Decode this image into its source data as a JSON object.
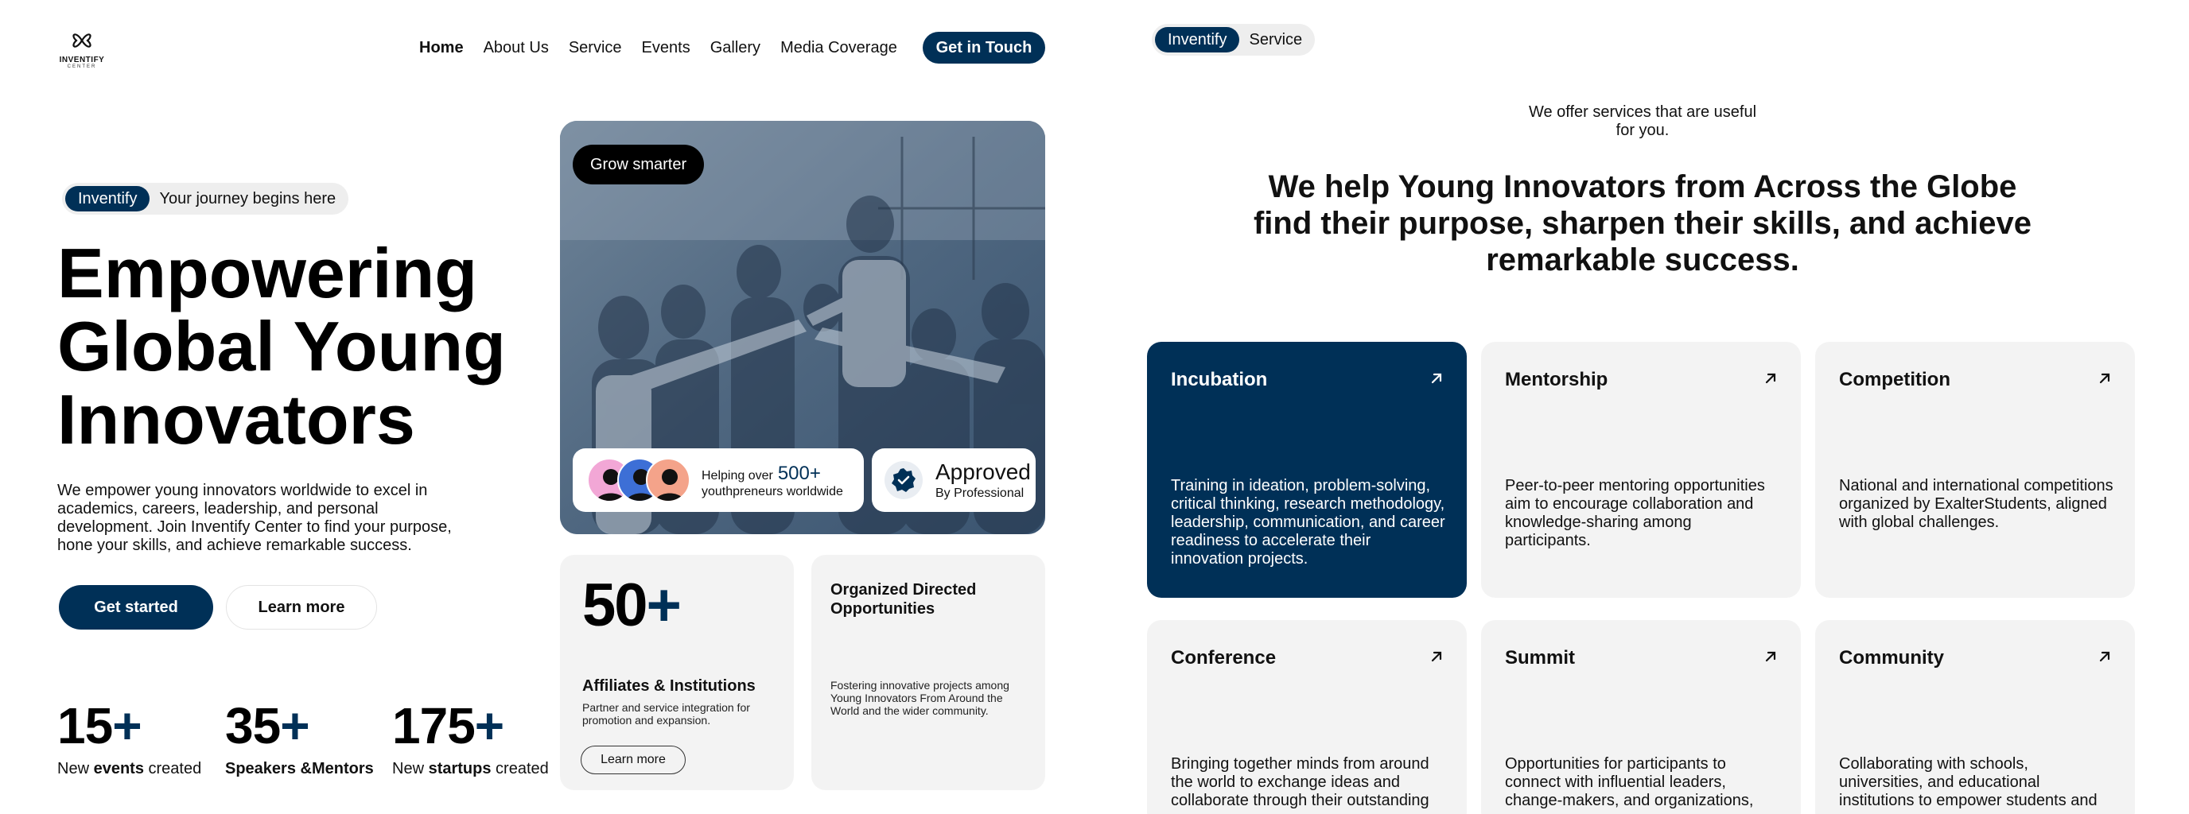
{
  "brand": {
    "name": "INVENTIFY",
    "sub": "CENTER"
  },
  "nav": {
    "items": [
      "Home",
      "About Us",
      "Service",
      "Events",
      "Gallery",
      "Media Coverage"
    ],
    "cta": "Get in Touch"
  },
  "hero": {
    "tag": "Inventify",
    "tagline": "Your journey begins here",
    "title_lines": [
      "Empowering",
      "Global Young",
      "Innovators"
    ],
    "description": "We empower young innovators worldwide to excel in academics, careers, leadership, and personal development. Join Inventify Center to find your purpose, hone your skills, and achieve remarkable success.",
    "primary_button": "Get started",
    "secondary_button": "Learn more"
  },
  "stats": [
    {
      "num": "15",
      "plus": "+",
      "pre": "New ",
      "bold": "events",
      "post": " created"
    },
    {
      "num": "35",
      "plus": "+",
      "pre": "",
      "bold": "Speakers &Mentors",
      "post": ""
    },
    {
      "num": "175",
      "plus": "+",
      "pre": "New ",
      "bold": "startups",
      "post": " created"
    }
  ],
  "photo_card": {
    "badge": "Grow smarter",
    "helping_prefix": "Helping over",
    "helping_count": "500+",
    "helping_suffix": "youthpreneurs worldwide",
    "approved_title": "Approved",
    "approved_sub": "By Professional"
  },
  "affiliates_card": {
    "number": "50",
    "plus": "+",
    "title": "Affiliates & Institutions",
    "description": "Partner and service integration for promotion and expansion.",
    "button": "Learn more"
  },
  "organized_card": {
    "title": "Organized Directed Opportunities",
    "description": "Fostering innovative projects among Young Innovators From Around the World and the wider community."
  },
  "services_page": {
    "tag": "Inventify",
    "tagline": "Service",
    "intro": "We offer services that are useful for you.",
    "headline": "We help Young Innovators from Across the Globe find their purpose, sharpen their skills, and achieve remarkable success.",
    "cards": [
      {
        "title": "Incubation",
        "description": "Training in ideation, problem-solving, critical thinking, research methodology, leadership, communication, and career readiness to accelerate their innovation projects."
      },
      {
        "title": "Mentorship",
        "description": "Peer-to-peer mentoring opportunities aim to encourage collaboration and knowledge-sharing among participants."
      },
      {
        "title": "Competition",
        "description": "National and international competitions organized by ExalterStudents, aligned with global challenges."
      },
      {
        "title": "Conference",
        "description": "Bringing together minds from around the world to exchange ideas and collaborate through their outstanding"
      },
      {
        "title": "Summit",
        "description": "Opportunities for participants to connect with influential leaders, change-makers, and organizations,"
      },
      {
        "title": "Community",
        "description": "Collaborating with schools, universities, and educational institutions to empower students and"
      }
    ]
  },
  "colors": {
    "navy": "#003057",
    "card_bg": "#f3f3f3",
    "text": "#111111"
  },
  "icons": [
    "logo-knot-icon",
    "arrow-up-right-icon",
    "verified-badge-icon",
    "person-avatar-icon"
  ]
}
